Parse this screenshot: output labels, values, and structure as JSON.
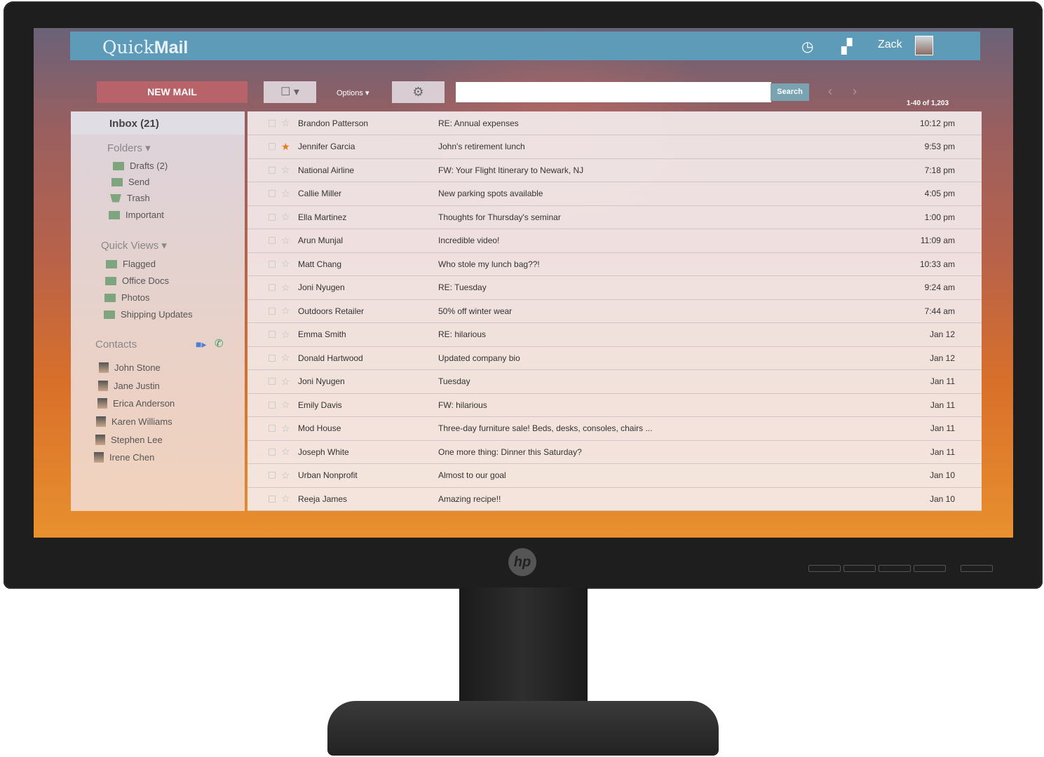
{
  "app": {
    "logo_light": "Quick",
    "logo_bold": "Mail",
    "user": "Zack"
  },
  "toolbar": {
    "new_mail": "NEW MAIL",
    "options": "Options ▾",
    "search_button": "Search",
    "search_value": "",
    "count": "1-40 of 1,203"
  },
  "sidebar": {
    "inbox": "Inbox (21)",
    "folders_label": "Folders ▾",
    "folders": [
      "Drafts (2)",
      "Send",
      "Trash",
      "Important"
    ],
    "quick_views_label": "Quick Views ▾",
    "quick_views": [
      "Flagged",
      "Office Docs",
      "Photos",
      "Shipping Updates"
    ],
    "contacts_label": "Contacts",
    "contacts": [
      "John Stone",
      "Jane Justin",
      "Erica Anderson",
      "Karen Williams",
      "Stephen Lee",
      "Irene Chen"
    ]
  },
  "emails": [
    {
      "from": "Brandon Patterson",
      "subject": "RE: Annual expenses",
      "time": "10:12 pm",
      "starred": false
    },
    {
      "from": "Jennifer Garcia",
      "subject": "John's retirement lunch",
      "time": "9:53 pm",
      "starred": true
    },
    {
      "from": "National Airline",
      "subject": "FW: Your Flight Itinerary to Newark, NJ",
      "time": "7:18 pm",
      "starred": false
    },
    {
      "from": "Callie Miller",
      "subject": "New parking spots available",
      "time": "4:05 pm",
      "starred": false
    },
    {
      "from": "Ella Martinez",
      "subject": "Thoughts for Thursday's seminar",
      "time": "1:00 pm",
      "starred": false
    },
    {
      "from": "Arun Munjal",
      "subject": "Incredible video!",
      "time": "11:09 am",
      "starred": false
    },
    {
      "from": "Matt Chang",
      "subject": "Who stole my lunch bag??!",
      "time": "10:33 am",
      "starred": false
    },
    {
      "from": "Joni Nyugen",
      "subject": "RE: Tuesday",
      "time": "9:24 am",
      "starred": false
    },
    {
      "from": "Outdoors Retailer",
      "subject": "50% off winter wear",
      "time": "7:44 am",
      "starred": false
    },
    {
      "from": "Emma Smith",
      "subject": "RE: hilarious",
      "time": "Jan 12",
      "starred": false
    },
    {
      "from": "Donald Hartwood",
      "subject": "Updated company bio",
      "time": "Jan 12",
      "starred": false
    },
    {
      "from": "Joni Nyugen",
      "subject": "Tuesday",
      "time": "Jan 11",
      "starred": false
    },
    {
      "from": "Emily Davis",
      "subject": "FW: hilarious",
      "time": "Jan 11",
      "starred": false
    },
    {
      "from": "Mod House",
      "subject": "Three-day furniture sale! Beds, desks, consoles, chairs ...",
      "time": "Jan 11",
      "starred": false
    },
    {
      "from": "Joseph White",
      "subject": "One more thing: Dinner this Saturday?",
      "time": "Jan 11",
      "starred": false
    },
    {
      "from": "Urban Nonprofit",
      "subject": "Almost to our goal",
      "time": "Jan 10",
      "starred": false
    },
    {
      "from": "Reeja James",
      "subject": "Amazing recipe!!",
      "time": "Jan 10",
      "starred": false
    }
  ],
  "colors": {
    "appbar": "#5e9bb8",
    "new_mail": "#b8626a",
    "star": "#e07b1e",
    "folder": "#7fa57f"
  },
  "brand": "hp"
}
